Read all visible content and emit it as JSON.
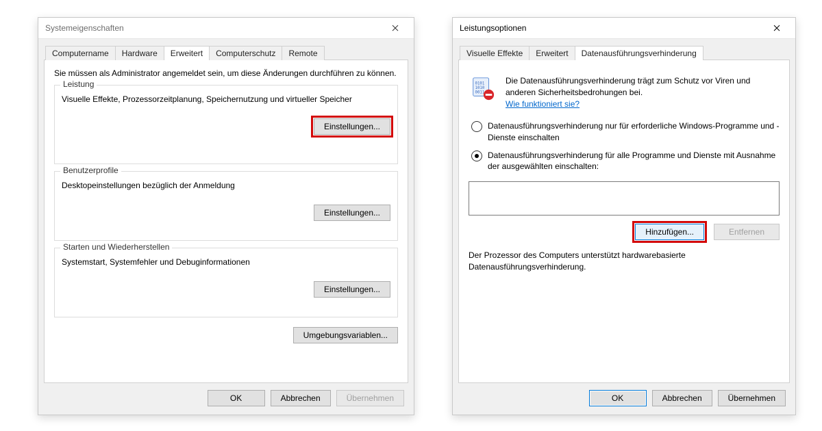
{
  "left": {
    "title": "Systemeigenschaften",
    "tabs": {
      "computername": "Computername",
      "hardware": "Hardware",
      "erweitert": "Erweitert",
      "computerschutz": "Computerschutz",
      "remote": "Remote"
    },
    "intro": "Sie müssen als Administrator angemeldet sein, um diese Änderungen durchführen zu können.",
    "performance": {
      "legend": "Leistung",
      "desc": "Visuelle Effekte, Prozessorzeitplanung, Speichernutzung und virtueller Speicher",
      "button": "Einstellungen..."
    },
    "profiles": {
      "legend": "Benutzerprofile",
      "desc": "Desktopeinstellungen bezüglich der Anmeldung",
      "button": "Einstellungen..."
    },
    "startup": {
      "legend": "Starten und Wiederherstellen",
      "desc": "Systemstart, Systemfehler und Debuginformationen",
      "button": "Einstellungen..."
    },
    "envvars": "Umgebungsvariablen...",
    "footer": {
      "ok": "OK",
      "cancel": "Abbrechen",
      "apply": "Übernehmen"
    }
  },
  "right": {
    "title": "Leistungsoptionen",
    "tabs": {
      "visuelle": "Visuelle Effekte",
      "erweitert": "Erweitert",
      "dep": "Datenausführungsverhinderung"
    },
    "dep_desc": "Die Datenausführungsverhinderung trägt zum Schutz vor Viren und anderen Sicherheitsbedrohungen bei.",
    "dep_link": "Wie funktioniert sie?",
    "radio1": "Datenausführungsverhinderung nur für erforderliche Windows-Programme und -Dienste einschalten",
    "radio2": "Datenausführungsverhinderung für alle Programme und Dienste mit Ausnahme der ausgewählten einschalten:",
    "add": "Hinzufügen...",
    "remove": "Entfernen",
    "support": "Der Prozessor des Computers unterstützt hardwarebasierte Datenausführungsverhinderung.",
    "footer": {
      "ok": "OK",
      "cancel": "Abbrechen",
      "apply": "Übernehmen"
    }
  }
}
